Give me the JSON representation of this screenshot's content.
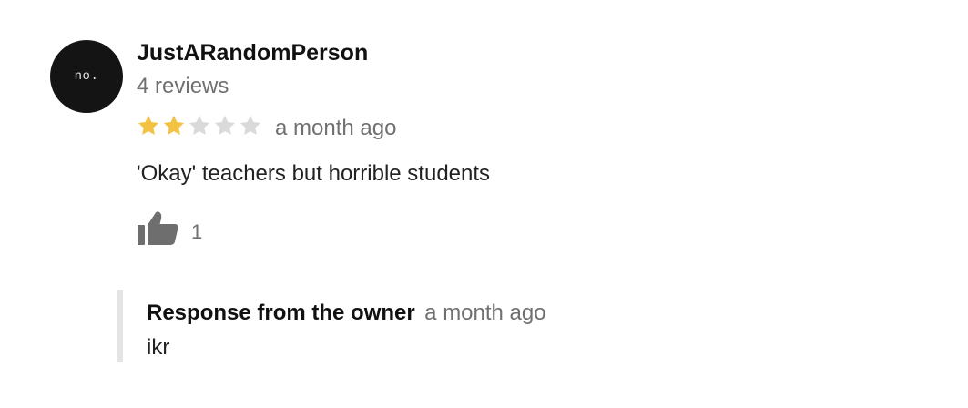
{
  "review": {
    "avatar_text": "no.",
    "reviewer_name": "JustARandomPerson",
    "review_count": "4 reviews",
    "rating": 2,
    "rating_max": 5,
    "date": "a month ago",
    "text": "'Okay' teachers but horrible students",
    "likes": "1"
  },
  "owner_response": {
    "label": "Response from the owner",
    "date": "a month ago",
    "text": "ikr"
  },
  "colors": {
    "star_filled": "#f4c242",
    "star_empty": "#dadada",
    "thumb": "#6e6e6e",
    "response_border": "#e4e4e4"
  },
  "icons": {
    "star": "star-icon",
    "like": "thumbs-up-icon"
  }
}
